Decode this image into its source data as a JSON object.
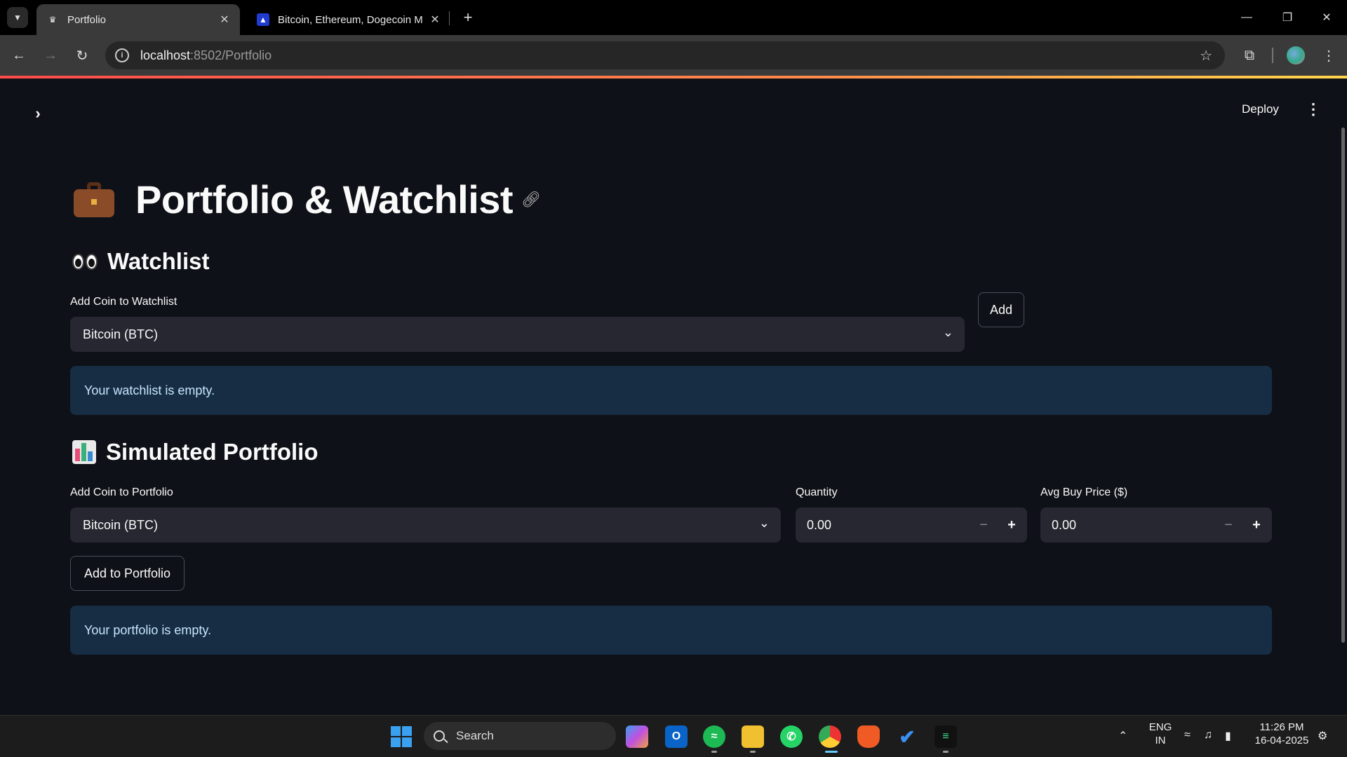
{
  "browser": {
    "tabs": [
      {
        "title": "Portfolio",
        "favicon": "crown-icon",
        "active": true
      },
      {
        "title": "Bitcoin, Ethereum, Dogecoin M",
        "favicon": "coin-icon",
        "active": false
      }
    ],
    "url_host": "localhost",
    "url_path": ":8502/Portfolio"
  },
  "app": {
    "deploy_label": "Deploy",
    "page_title": "Portfolio & Watchlist",
    "watchlist": {
      "heading": "Watchlist",
      "select_label": "Add Coin to Watchlist",
      "selected_coin": "Bitcoin (BTC)",
      "add_button": "Add",
      "empty_message": "Your watchlist is empty."
    },
    "portfolio": {
      "heading": "Simulated Portfolio",
      "select_label": "Add Coin to Portfolio",
      "selected_coin": "Bitcoin (BTC)",
      "quantity_label": "Quantity",
      "quantity_value": "0.00",
      "price_label": "Avg Buy Price ($)",
      "price_value": "0.00",
      "add_button": "Add to Portfolio",
      "empty_message": "Your portfolio is empty."
    }
  },
  "taskbar": {
    "search_placeholder": "Search",
    "language": "ENG",
    "region": "IN",
    "time": "11:26 PM",
    "date": "16-04-2025"
  },
  "colors": {
    "app_background": "#0e1117",
    "widget_background": "#262730",
    "info_background": "#172d43",
    "info_text": "#c7e6ff",
    "accent_gradient_start": "#ff4b4b",
    "accent_gradient_end": "#ffd54b"
  }
}
